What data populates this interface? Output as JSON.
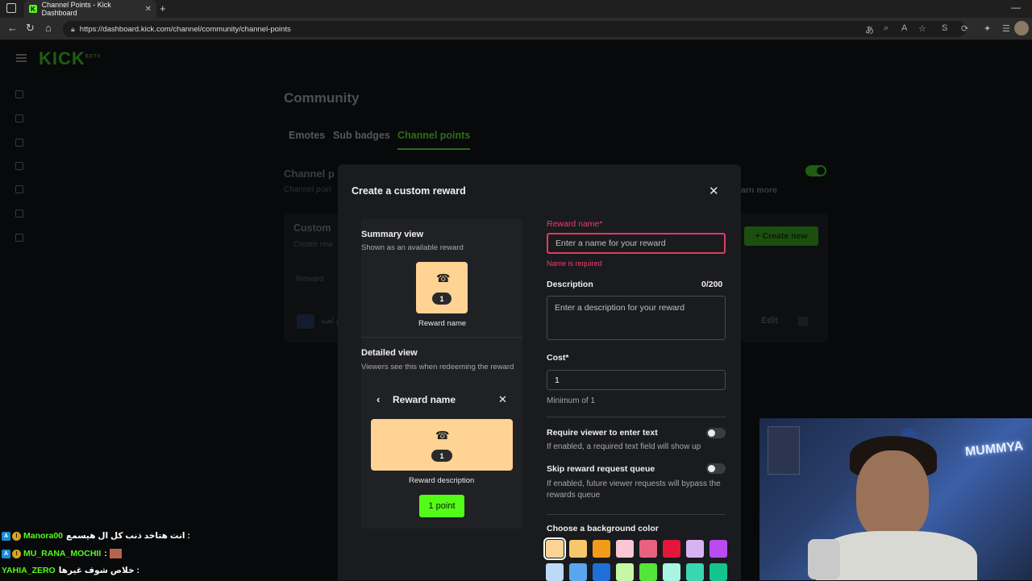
{
  "browser": {
    "tab_title": "Channel Points - Kick Dashboard",
    "tab_favicon": "K",
    "url": "https://dashboard.kick.com/channel/community/channel-points",
    "new_tab": "+",
    "minimize": "—"
  },
  "app": {
    "logo": "KICK",
    "logo_beta": "BETA",
    "page_title": "Community",
    "tabs": [
      {
        "label": "Emotes",
        "active": false
      },
      {
        "label": "Sub badges",
        "active": false
      },
      {
        "label": "Channel points",
        "active": true
      }
    ],
    "bg_section_title": "Channel p",
    "bg_section_sub": "Channel poin",
    "bg_learn_more": "arn more",
    "bg_custom_title": "Custom",
    "bg_custom_sub": "Create rew",
    "bg_create_new": "+ Create new",
    "bg_table_header": "Reward",
    "bg_row_text": "ع لعبة",
    "bg_edit": "Edit"
  },
  "modal": {
    "title": "Create a custom reward",
    "summary_title": "Summary view",
    "summary_sub": "Shown as an available reward",
    "card_icon": "☎",
    "card_cost": "1",
    "card_name": "Reward name",
    "detailed_title": "Detailed view",
    "detailed_sub": "Viewers see this when redeeming the reward",
    "detail_header_name": "Reward name",
    "detail_description": "Reward description",
    "point_button": "1 point",
    "reward_name_label": "Reward name*",
    "reward_name_placeholder": "Enter a name for your reward",
    "reward_name_error": "Name is required",
    "description_label": "Description",
    "description_counter": "0/200",
    "description_placeholder": "Enter a description for your reward",
    "cost_label": "Cost*",
    "cost_value": "1",
    "cost_help": "Minimum of 1",
    "require_text_label": "Require viewer to enter text",
    "require_text_help": "If enabled, a required text field will show up",
    "skip_queue_label": "Skip reward request queue",
    "skip_queue_help": "If enabled, future viewer requests will bypass the rewards queue",
    "bg_color_label": "Choose a background color",
    "swatches_row1": [
      "#ffd393",
      "#f7c86a",
      "#f39b18",
      "#f9c6d3",
      "#e8617f",
      "#e3163c",
      "#d8b3f3",
      "#b84cf0"
    ],
    "swatches_row2": [
      "#bcd9f7",
      "#5aa6ee",
      "#1f6fd8",
      "#c7f7a6",
      "#53e53a",
      "#a8f5e6",
      "#3ad6b0",
      "#14c48e"
    ]
  },
  "chat": [
    {
      "user": "Manora00",
      "message": "انت هتاخد ذنب كل ال هيسمع :",
      "emote": false
    },
    {
      "user": "MU_RANA_MOCHII",
      "message": ":",
      "emote": true
    },
    {
      "user": "YAHIA_ZERO",
      "message": "خلاص شوف غيرها :",
      "emote": false
    }
  ],
  "webcam": {
    "neon_sign": "MUMMYA"
  },
  "colors": {
    "accent": "#53fc18",
    "error": "#ec3e6a",
    "card": "#ffd393"
  }
}
